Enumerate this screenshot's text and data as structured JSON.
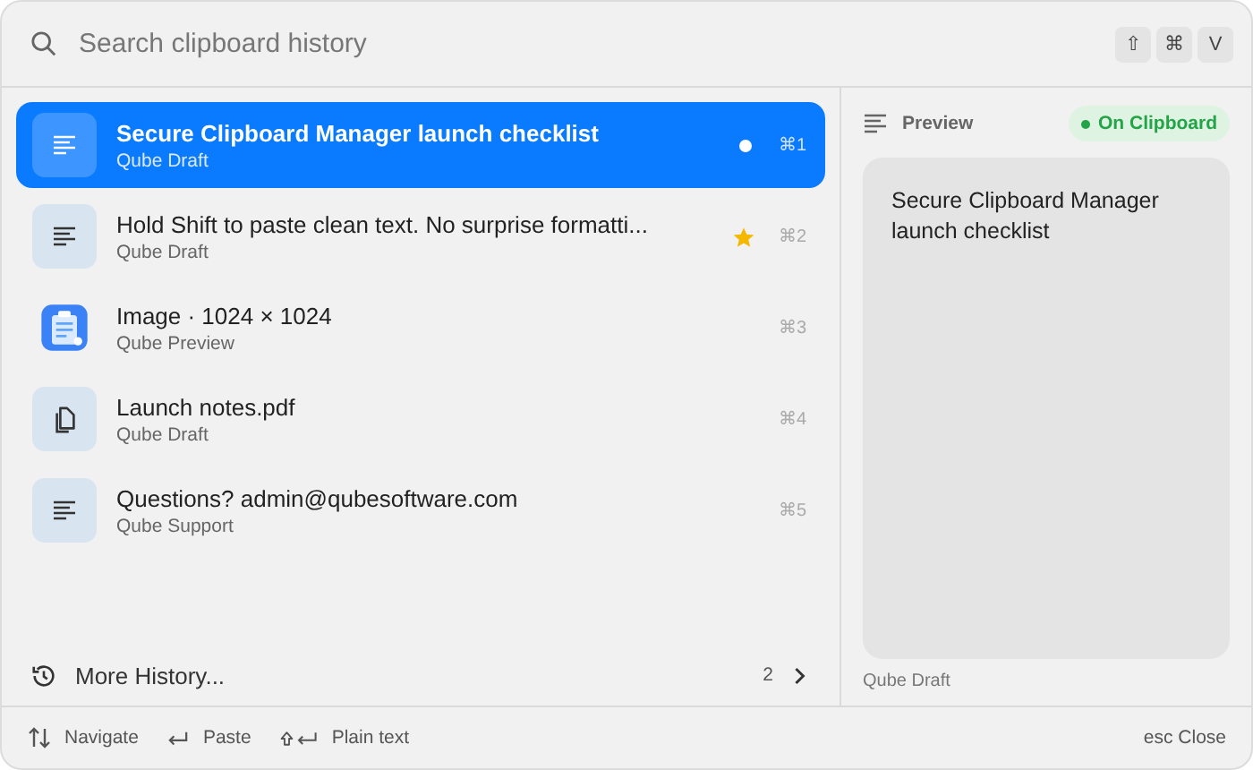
{
  "search": {
    "placeholder": "Search clipboard history",
    "keys": [
      "⇧",
      "⌘",
      "V"
    ]
  },
  "items": [
    {
      "kind": "text",
      "title": "Secure Clipboard Manager launch checklist",
      "source": "Qube Draft",
      "shortcut": "⌘1",
      "selected": true,
      "on_clipboard": true,
      "starred": false
    },
    {
      "kind": "text",
      "title": "Hold Shift to paste clean text. No surprise formatti...",
      "source": "Qube Draft",
      "shortcut": "⌘2",
      "selected": false,
      "on_clipboard": false,
      "starred": true
    },
    {
      "kind": "image",
      "title": "Image · 1024 × 1024",
      "source": "Qube Preview",
      "shortcut": "⌘3",
      "selected": false,
      "on_clipboard": false,
      "starred": false
    },
    {
      "kind": "file",
      "title": "Launch notes.pdf",
      "source": "Qube Draft",
      "shortcut": "⌘4",
      "selected": false,
      "on_clipboard": false,
      "starred": false
    },
    {
      "kind": "text",
      "title": "Questions? admin@qubesoftware.com",
      "source": "Qube Support",
      "shortcut": "⌘5",
      "selected": false,
      "on_clipboard": false,
      "starred": false
    }
  ],
  "more_history": {
    "label": "More History...",
    "count": "2"
  },
  "preview": {
    "label": "Preview",
    "badge": "On Clipboard",
    "text": "Secure Clipboard Manager launch checklist",
    "source": "Qube Draft"
  },
  "footer": {
    "hints": [
      {
        "kind": "navigate",
        "label": "Navigate"
      },
      {
        "kind": "paste",
        "label": "Paste"
      },
      {
        "kind": "plain",
        "label": "Plain text"
      }
    ],
    "close_key": "esc",
    "close_label": "Close"
  }
}
